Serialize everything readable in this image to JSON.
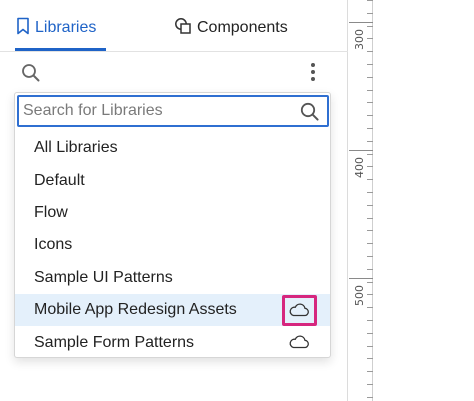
{
  "tabs": {
    "libraries_label": "Libraries",
    "components_label": "Components"
  },
  "toolbar": {
    "search_icon": "search-icon",
    "more_icon": "more-vertical-icon"
  },
  "library_dropdown": {
    "search_placeholder": "Search for Libraries",
    "items": [
      {
        "label": "All Libraries",
        "selected": false,
        "cloud": false
      },
      {
        "label": "Default",
        "selected": false,
        "cloud": false
      },
      {
        "label": "Flow",
        "selected": false,
        "cloud": false
      },
      {
        "label": "Icons",
        "selected": false,
        "cloud": false
      },
      {
        "label": "Sample UI Patterns",
        "selected": false,
        "cloud": false
      },
      {
        "label": "Mobile App Redesign Assets",
        "selected": true,
        "cloud": true,
        "highlighted": true
      },
      {
        "label": "Sample Form Patterns",
        "selected": false,
        "cloud": true
      }
    ]
  },
  "ruler": {
    "labels": [
      "300",
      "400",
      "500"
    ]
  },
  "colors": {
    "accent": "#1f63c7",
    "selected_row": "#e4f0fb",
    "highlight": "#d6267e"
  }
}
